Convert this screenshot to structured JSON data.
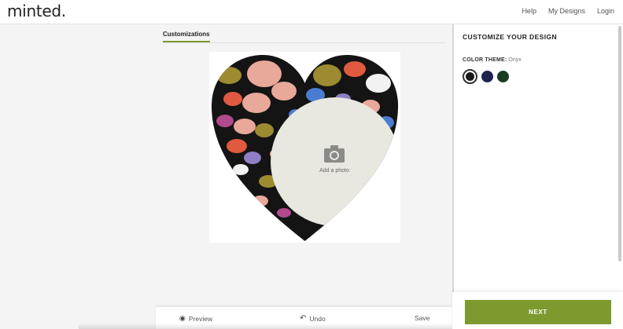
{
  "header": {
    "logo": "minted.",
    "nav": [
      "Help",
      "My Designs",
      "Login"
    ]
  },
  "tabs": {
    "active": "Customizations"
  },
  "canvas": {
    "photo_placeholder": "Add a photo",
    "heart_fill": "#141414",
    "photo_fill": "#e8e8e1",
    "icon_color": "#8a8a86"
  },
  "panel": {
    "title": "CUSTOMIZE YOUR DESIGN",
    "color_theme_label": "COLOR THEME:",
    "color_theme_value": "Onyx",
    "swatches": [
      {
        "name": "Onyx",
        "color": "#1a1a1a",
        "selected": true
      },
      {
        "name": "Navy",
        "color": "#1e2350",
        "selected": false
      },
      {
        "name": "Forest",
        "color": "#183b22",
        "selected": false
      }
    ]
  },
  "toolbar": {
    "preview": "Preview",
    "undo": "Undo",
    "save": "Save"
  },
  "next_label": "NEXT",
  "colors": {
    "accent": "#7c9a2e"
  }
}
